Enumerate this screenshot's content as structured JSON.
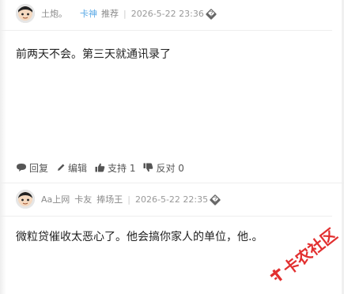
{
  "posts": [
    {
      "user": "土炮。",
      "role_badge": "卡神",
      "tag": "推荐",
      "time": "2026-5-22 23:36",
      "more_glyph": "�",
      "content": "前两天不会。第三天就通讯录了",
      "actions": {
        "reply": "回复",
        "edit": "编辑",
        "support": "支持 1",
        "oppose": "反对 0"
      }
    },
    {
      "user": "Aa上网",
      "tag_1": "卡友",
      "tag_2": "捧场王",
      "time": "2026-5-22 22:35",
      "more_glyph": "�",
      "content": "微粒贷催收太恶心了。他会搞你家人的单位，他.。"
    }
  ],
  "watermark": {
    "text": "卡农社区",
    "brand_color": "#e23030"
  },
  "colors": {
    "role_badge": "#5aa9e6",
    "meta_text": "#999999",
    "content_text": "#222222"
  },
  "icons": {
    "reply": "reply-bubble-icon",
    "edit": "pencil-icon",
    "support": "thumbs-up-icon",
    "oppose": "thumbs-down-icon",
    "more": "diamond-question-icon"
  }
}
